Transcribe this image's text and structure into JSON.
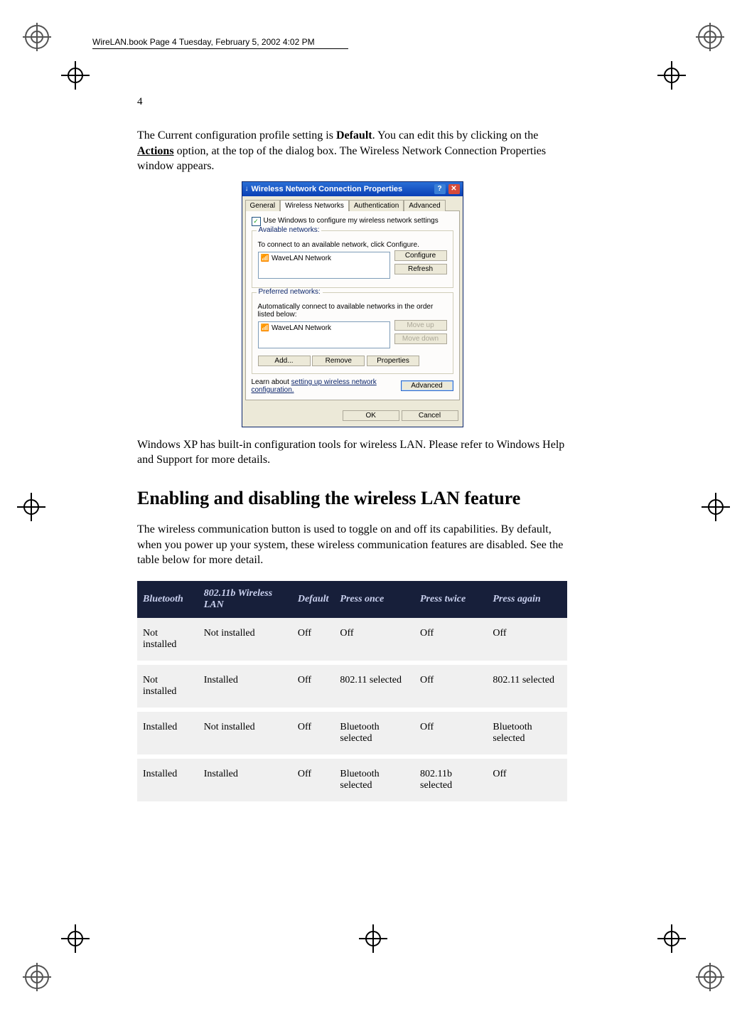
{
  "running_header": "WireLAN.book  Page 4  Tuesday, February 5, 2002  4:02 PM",
  "page_number": "4",
  "para1_a": "The Current configuration profile setting is ",
  "para1_bold": "Default",
  "para1_b": ".  You can edit this by clicking on the ",
  "para1_link": "Actions",
  "para1_c": " option, at the top of the dialog box.  The Wireless Network Connection Properties window appears.",
  "dialog": {
    "title": "Wireless Network Connection Properties",
    "tabs": [
      "General",
      "Wireless Networks",
      "Authentication",
      "Advanced"
    ],
    "active_tab": 1,
    "use_windows": "Use Windows to configure my wireless network settings",
    "group1": {
      "label": "Available networks:",
      "desc": "To connect to an available network, click Configure.",
      "item": "WaveLAN Network",
      "btn_configure": "Configure",
      "btn_refresh": "Refresh"
    },
    "group2": {
      "label": "Preferred networks:",
      "desc": "Automatically connect to available networks in the order listed below:",
      "item": "WaveLAN Network",
      "btn_up": "Move up",
      "btn_down": "Move down",
      "btn_add": "Add...",
      "btn_remove": "Remove",
      "btn_props": "Properties"
    },
    "learn_a": "Learn about ",
    "learn_link": "setting up wireless network configuration.",
    "btn_advanced": "Advanced",
    "btn_ok": "OK",
    "btn_cancel": "Cancel"
  },
  "para2": "Windows XP has built-in configuration tools for wireless LAN.  Please refer to Windows Help and Support for more details.",
  "heading": "Enabling and disabling the wireless LAN feature",
  "para3": "The wireless communication button is used to toggle on and off its capabilities.  By default, when you power up your system, these wireless communication features are disabled.  See the table below for more detail.",
  "table": {
    "headers": [
      "Bluetooth",
      "802.11b Wireless LAN",
      "Default",
      "Press once",
      "Press twice",
      "Press again"
    ],
    "rows": [
      [
        "Not installed",
        "Not installed",
        "Off",
        "Off",
        "Off",
        "Off"
      ],
      [
        "Not installed",
        "Installed",
        "Off",
        "802.11 selected",
        "Off",
        "802.11 selected"
      ],
      [
        "Installed",
        "Not installed",
        "Off",
        "Bluetooth selected",
        "Off",
        "Bluetooth selected"
      ],
      [
        "Installed",
        "Installed",
        "Off",
        "Bluetooth selected",
        "802.11b selected",
        "Off"
      ]
    ]
  }
}
